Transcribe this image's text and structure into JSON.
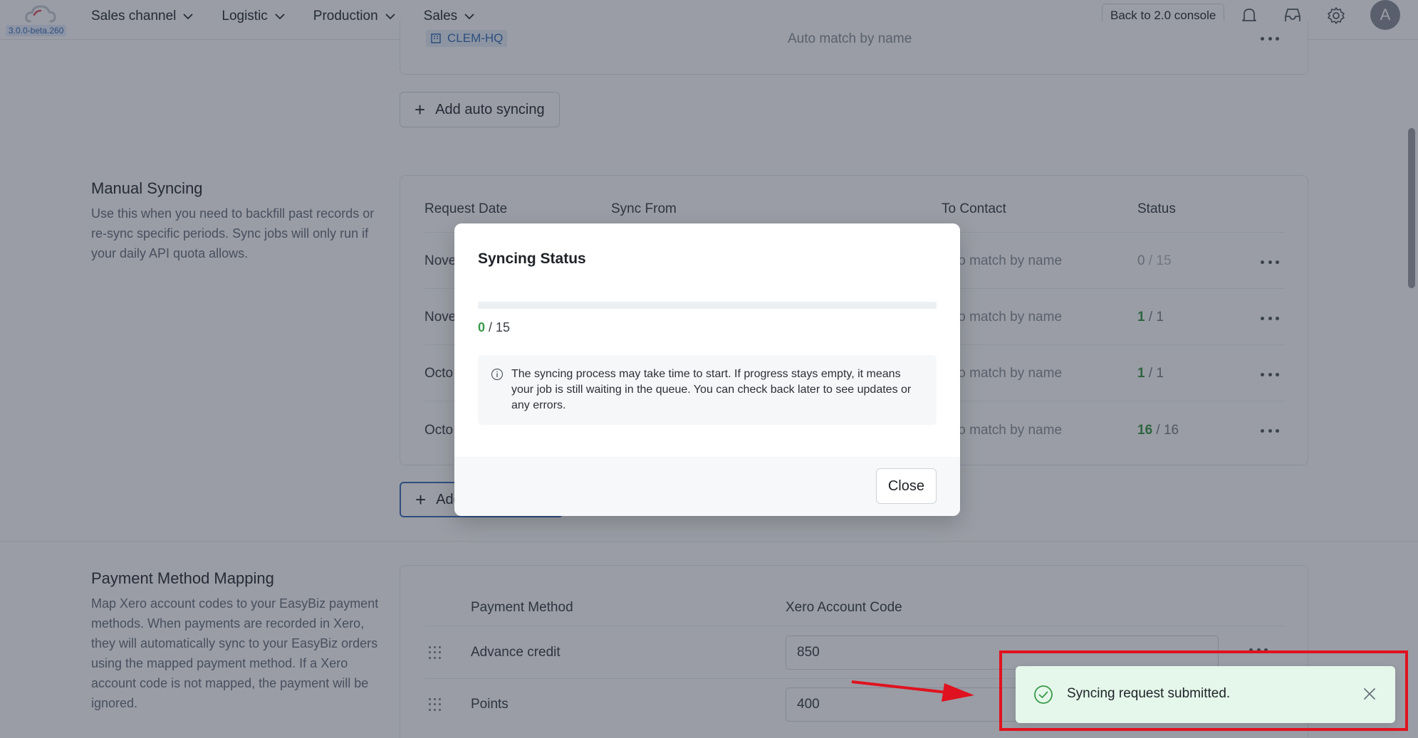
{
  "header": {
    "version": "3.0.0-beta.260",
    "nav": [
      "Sales channel",
      "Logistic",
      "Production",
      "Sales"
    ],
    "back_button": "Back to 2.0 console",
    "avatar_initial": "A"
  },
  "auto_syncing": {
    "tag": "CLEM-HQ",
    "contact": "Auto match by name",
    "add_button": "Add auto syncing"
  },
  "manual_syncing": {
    "title": "Manual Syncing",
    "description": "Use this when you need to backfill past records or re-sync specific periods. Sync jobs will only run if your daily API quota allows.",
    "columns": [
      "Request Date",
      "Sync From",
      "To Contact",
      "Status"
    ],
    "rows": [
      {
        "date": "Nove",
        "contact": "to match by name",
        "status_done": "0",
        "status_total": "/ 15"
      },
      {
        "date": "Nove",
        "contact": "to match by name",
        "status_done": "1",
        "status_total": "/ 1"
      },
      {
        "date": "Octo",
        "contact": "to match by name",
        "status_done": "1",
        "status_total": "/ 1"
      },
      {
        "date": "Octo",
        "contact": "to match by name",
        "status_done": "16",
        "status_total": "/ 16"
      }
    ],
    "add_button": "Add"
  },
  "payment_mapping": {
    "title": "Payment Method Mapping",
    "description": "Map Xero account codes to your EasyBiz payment methods. When payments are recorded in Xero, they will automatically sync to your EasyBiz orders using the mapped payment method. If a Xero account code is not mapped, the payment will be ignored.",
    "columns": [
      "Payment Method",
      "Xero Account Code"
    ],
    "rows": [
      {
        "method": "Advance credit",
        "code": "850"
      },
      {
        "method": "Points",
        "code": "400"
      }
    ]
  },
  "modal": {
    "title": "Syncing Status",
    "progress_done": "0",
    "progress_total": "/ 15",
    "progress_fraction": 0,
    "info_text": "The syncing process may take time to start. If progress stays empty, it means your job is still waiting in the queue. You can check back later to see updates or any errors.",
    "close_label": "Close"
  },
  "toast": {
    "message": "Syncing request submitted."
  },
  "colors": {
    "success": "#3a9a4a",
    "annotation": "#e0121f",
    "toast_bg": "#e4f7ea"
  }
}
